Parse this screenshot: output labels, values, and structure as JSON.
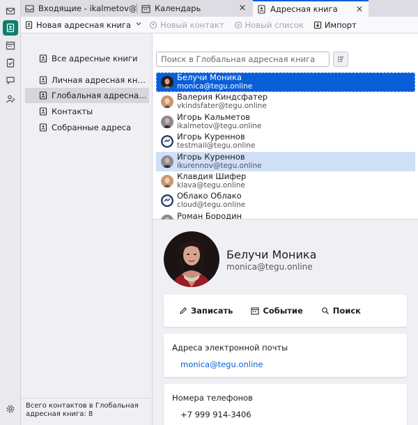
{
  "spaces": [
    {
      "icon": "mail-icon",
      "active": false
    },
    {
      "icon": "address-book-icon",
      "active": true
    },
    {
      "icon": "calendar-icon",
      "active": false
    },
    {
      "icon": "tasks-icon",
      "active": false
    },
    {
      "icon": "chat-icon",
      "active": false
    },
    {
      "icon": "account-icon",
      "active": false
    },
    {
      "icon": "settings-icon",
      "active": false
    }
  ],
  "tabs": [
    {
      "label": "Входящие - ikalmetov@mb",
      "icon": "inbox-icon",
      "active": false
    },
    {
      "label": "Календарь",
      "icon": "calendar-icon",
      "active": false,
      "close": "×"
    },
    {
      "label": "Адресная книга",
      "icon": "address-book-icon",
      "active": true,
      "close": "×"
    }
  ],
  "toolbar": {
    "new_book": "Новая адресная книга",
    "new_contact": "Новый контакт",
    "new_list": "Новый список",
    "import": "Импорт"
  },
  "books": {
    "items": [
      {
        "label": "Все адресные книги",
        "selected": false
      },
      {
        "label": "Личная адресная книга",
        "selected": false
      },
      {
        "label": "Глобальная адресная ...",
        "selected": true
      },
      {
        "label": "Контакты",
        "selected": false
      },
      {
        "label": "Собранные адреса",
        "selected": false
      }
    ],
    "footer": "Всего контактов в Глобальная адресная книга: 8"
  },
  "search": {
    "placeholder": "Поиск в Глобальная адресная книга"
  },
  "contacts": [
    {
      "name": "Белучи Моника",
      "email": "monica@tegu.online",
      "state": "selected",
      "avatar": "photo-woman-dark"
    },
    {
      "name": "Валерия Киндсфатер",
      "email": "vkindsfater@tegu.online",
      "state": "",
      "avatar": "photo-woman-light"
    },
    {
      "name": "Игорь Кальметов",
      "email": "ikalmetov@tegu.online",
      "state": "",
      "avatar": "photo-man"
    },
    {
      "name": "Игорь Куреннов",
      "email": "testmail@tegu.online",
      "state": "",
      "avatar": "logo"
    },
    {
      "name": "Игорь Куреннов",
      "email": "ikurennov@tegu.online",
      "state": "hover",
      "avatar": "photo-man"
    },
    {
      "name": "Клавдия Шифер",
      "email": "klava@tegu.online",
      "state": "",
      "avatar": "photo-woman-light"
    },
    {
      "name": "Облако Облако",
      "email": "cloud@tegu.online",
      "state": "",
      "avatar": "logo"
    },
    {
      "name": "Роман Бородин",
      "email": "",
      "state": "",
      "avatar": "photo-man"
    }
  ],
  "detail": {
    "name": "Белучи Моника",
    "email": "monica@tegu.online",
    "actions": {
      "write": "Записать",
      "event": "Событие",
      "search": "Поиск"
    },
    "emails_title": "Адреса электронной почты",
    "emails_value": "monica@tegu.online",
    "phones_title": "Номера телефонов",
    "phones_value": "+7 999 914-3406"
  }
}
